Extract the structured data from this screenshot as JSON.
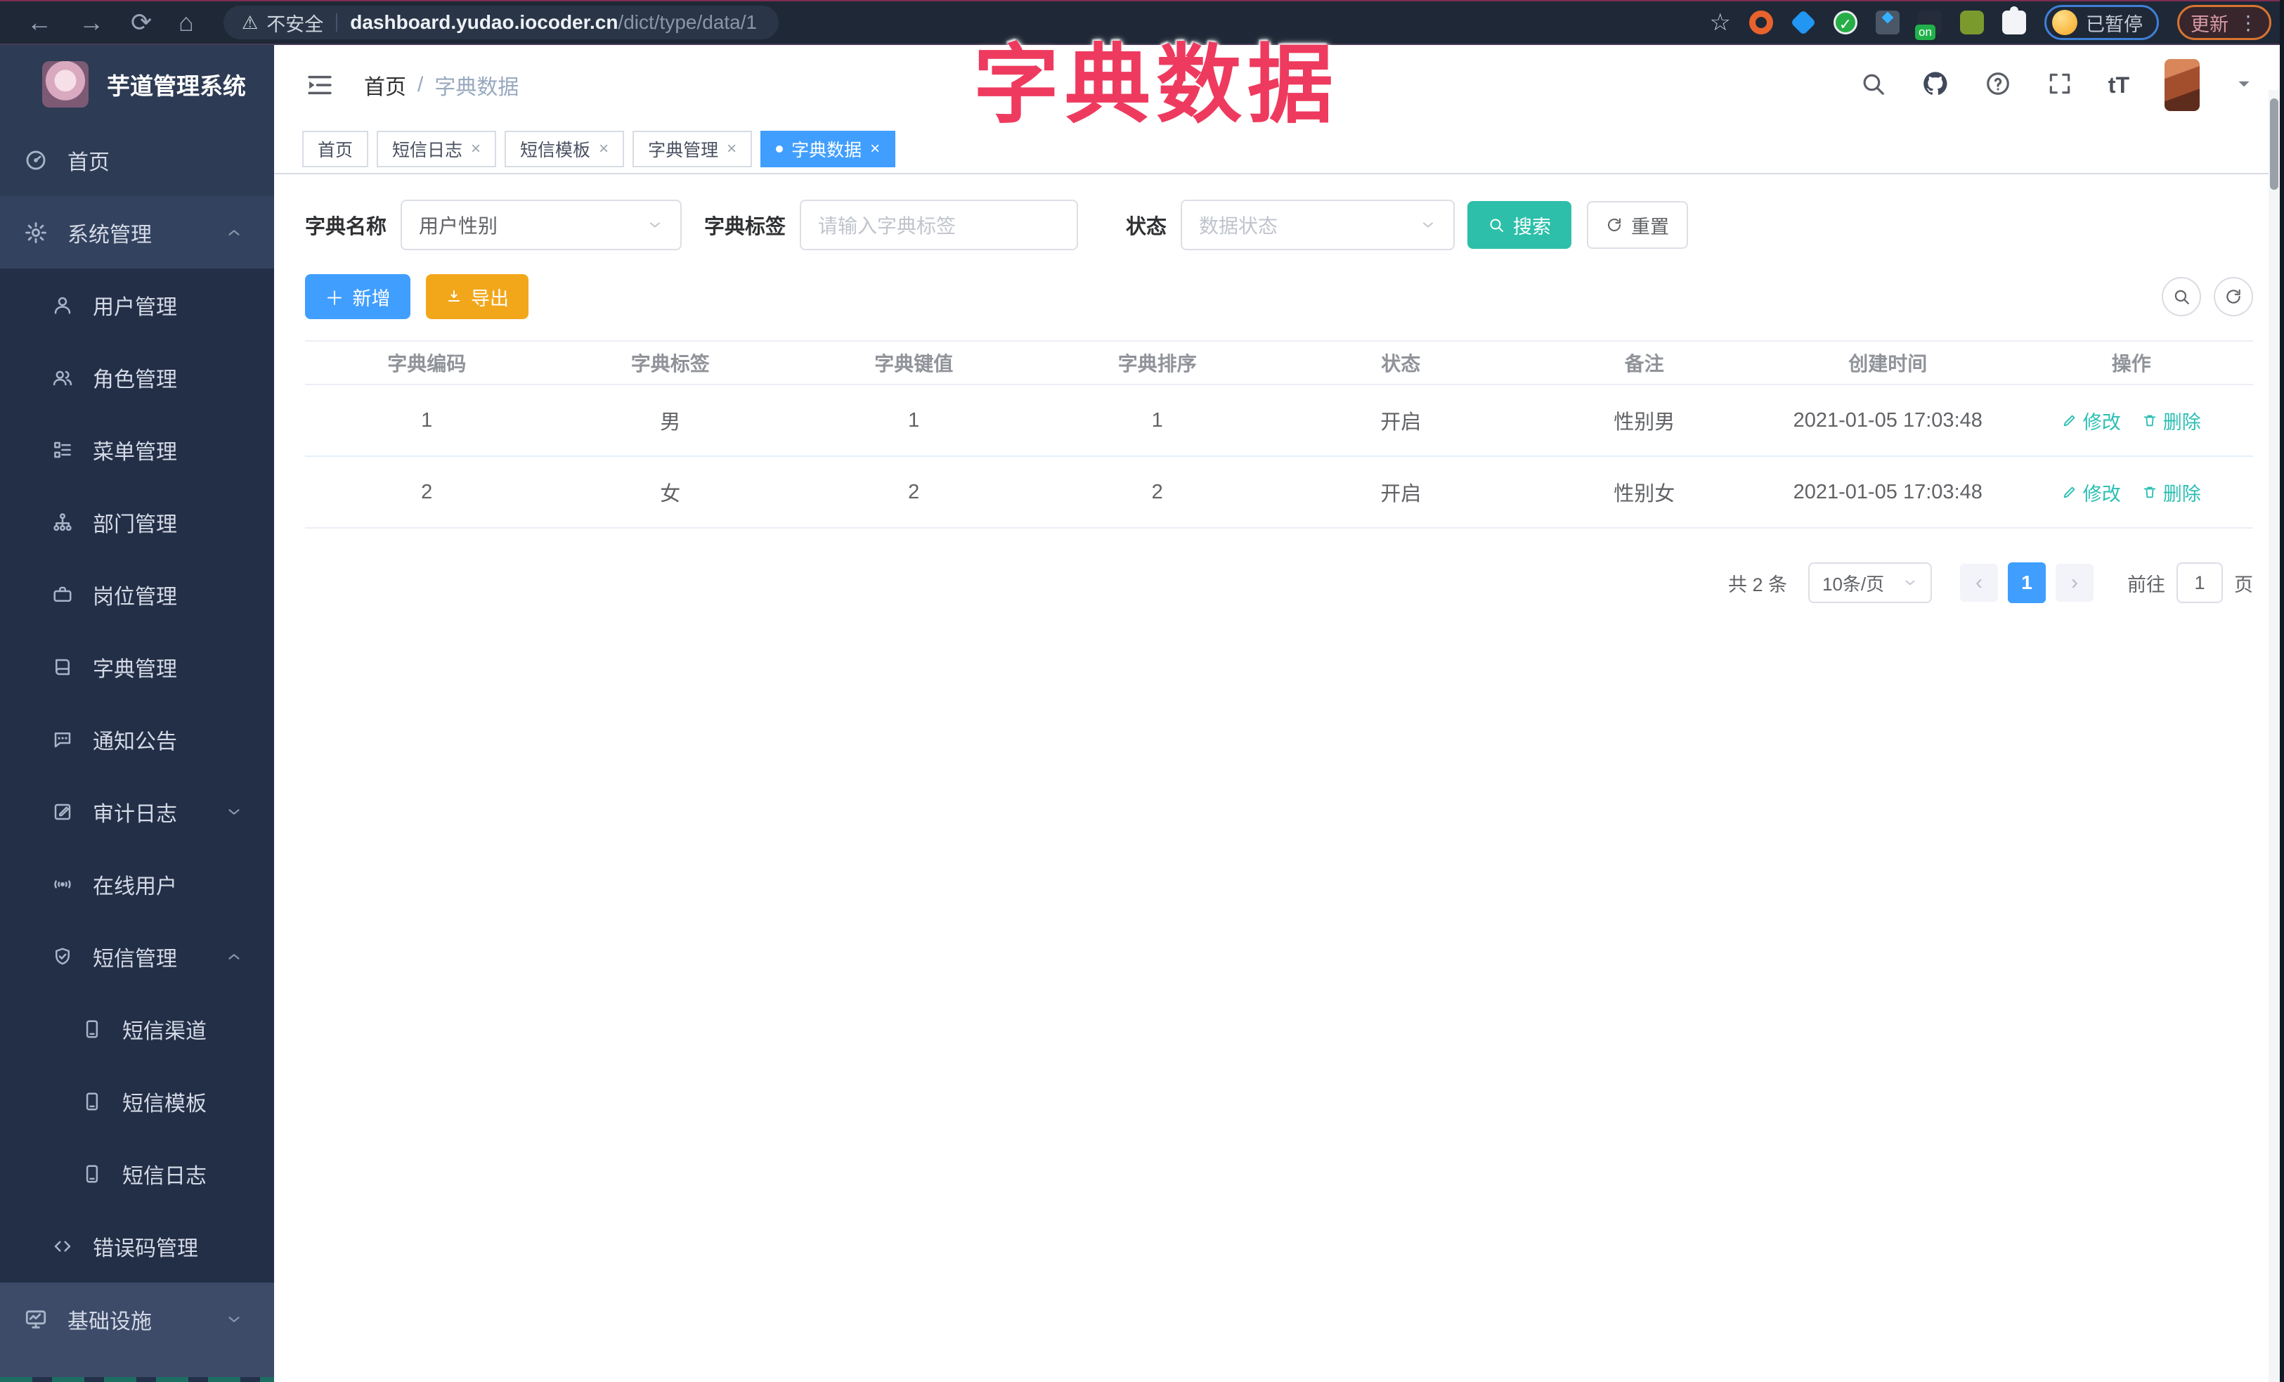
{
  "overlay": {
    "title": "字典数据"
  },
  "browser": {
    "security_label": "不安全",
    "url_host": "dashboard.yudao.iocoder.cn",
    "url_path": "/dict/type/data/1",
    "on_badge": "on",
    "paused_label": "已暂停",
    "update_label": "更新",
    "kebab": "⋮"
  },
  "sidebar": {
    "app_title": "芋道管理系统",
    "items": [
      {
        "label": "首页"
      },
      {
        "label": "系统管理"
      },
      {
        "label": "用户管理"
      },
      {
        "label": "角色管理"
      },
      {
        "label": "菜单管理"
      },
      {
        "label": "部门管理"
      },
      {
        "label": "岗位管理"
      },
      {
        "label": "字典管理"
      },
      {
        "label": "通知公告"
      },
      {
        "label": "审计日志"
      },
      {
        "label": "在线用户"
      },
      {
        "label": "短信管理"
      },
      {
        "label": "短信渠道"
      },
      {
        "label": "短信模板"
      },
      {
        "label": "短信日志"
      },
      {
        "label": "错误码管理"
      },
      {
        "label": "基础设施"
      }
    ]
  },
  "header": {
    "breadcrumb_home": "首页",
    "breadcrumb_sep": "/",
    "breadcrumb_current": "字典数据",
    "font_size_icon": "tT"
  },
  "tabs": [
    {
      "label": "首页"
    },
    {
      "label": "短信日志"
    },
    {
      "label": "短信模板"
    },
    {
      "label": "字典管理"
    },
    {
      "label": "字典数据"
    }
  ],
  "filters": {
    "name_label": "字典名称",
    "name_value": "用户性别",
    "label_label": "字典标签",
    "label_placeholder": "请输入字典标签",
    "status_label": "状态",
    "status_placeholder": "数据状态",
    "search_label": "搜索",
    "reset_label": "重置"
  },
  "toolbar": {
    "add_label": "新增",
    "export_label": "导出"
  },
  "table": {
    "headers": [
      "字典编码",
      "字典标签",
      "字典键值",
      "字典排序",
      "状态",
      "备注",
      "创建时间",
      "操作"
    ],
    "rows": [
      {
        "cells": [
          "1",
          "男",
          "1",
          "1",
          "开启",
          "性别男",
          "2021-01-05 17:03:48"
        ]
      },
      {
        "cells": [
          "2",
          "女",
          "2",
          "2",
          "开启",
          "性别女",
          "2021-01-05 17:03:48"
        ]
      }
    ],
    "edit_label": "修改",
    "delete_label": "删除"
  },
  "pagination": {
    "total": "共 2 条",
    "size": "10条/页",
    "current": "1",
    "goto_label": "前往",
    "goto_value": "1",
    "unit": "页"
  },
  "colors": {
    "accent_blue": "#409eff",
    "teal": "#2dbfa9",
    "warning_orange": "#f2a71b",
    "overlay_pink": "#ee3a5e",
    "sidebar_bg": "#2d3b54"
  }
}
